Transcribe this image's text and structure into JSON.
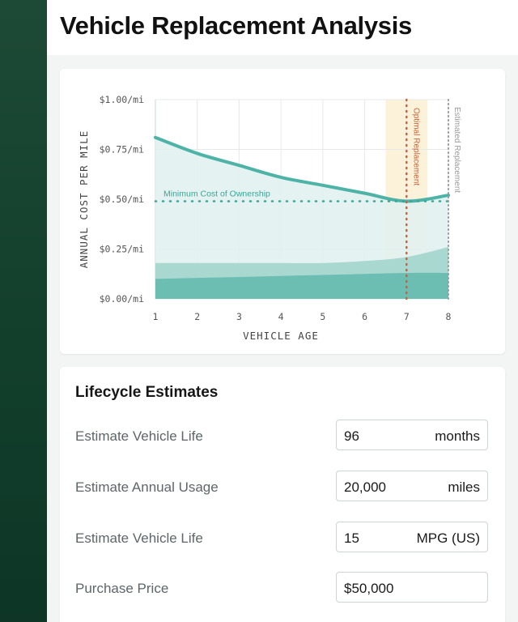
{
  "page": {
    "title": "Vehicle Replacement Analysis"
  },
  "chart_data": {
    "type": "area",
    "xlabel": "VEHICLE AGE",
    "ylabel": "ANNUAL COST PER MILE",
    "x": [
      1,
      2,
      3,
      4,
      5,
      6,
      7,
      8
    ],
    "xticks": [
      "1",
      "2",
      "3",
      "4",
      "5",
      "6",
      "7",
      "8"
    ],
    "yticks": [
      {
        "value": 0.0,
        "label": "$0.00/mi"
      },
      {
        "value": 0.25,
        "label": "$0.25/mi"
      },
      {
        "value": 0.5,
        "label": "$0.50/mi"
      },
      {
        "value": 0.75,
        "label": "$0.75/mi"
      },
      {
        "value": 1.0,
        "label": "$1.00/mi"
      }
    ],
    "xlim": [
      1,
      8
    ],
    "ylim": [
      0,
      1
    ],
    "grid": true,
    "series": [
      {
        "values": [
          0.81,
          0.73,
          0.67,
          0.61,
          0.57,
          0.53,
          0.49,
          0.52
        ],
        "color": "#4db3a7"
      },
      {
        "values": [
          0.18,
          0.18,
          0.18,
          0.18,
          0.18,
          0.19,
          0.21,
          0.26
        ],
        "color": "#a9d8d1"
      },
      {
        "values": [
          0.1,
          0.105,
          0.11,
          0.115,
          0.12,
          0.125,
          0.13,
          0.13
        ],
        "color": "#6cbdb2"
      }
    ],
    "annotations": [
      {
        "type": "hline",
        "y": 0.49,
        "label": "Minimum Cost of Ownership",
        "color": "#3aa597"
      },
      {
        "type": "vline",
        "x": 7,
        "label": "Optimal Replacement",
        "color": "#c8643a",
        "band": [
          6.5,
          7.5
        ],
        "band_color": "#fcf1d9"
      },
      {
        "type": "vline",
        "x": 8,
        "label": "Estimated Replacement",
        "color": "#9a9a9a"
      }
    ]
  },
  "form": {
    "title": "Lifecycle Estimates",
    "rows": [
      {
        "label": "Estimate Vehicle Life",
        "value": "96",
        "unit": "months"
      },
      {
        "label": "Estimate Annual Usage",
        "value": "20,000",
        "unit": "miles"
      },
      {
        "label": "Estimate Vehicle Life",
        "value": "15",
        "unit": "MPG (US)"
      },
      {
        "label": "Purchase Price",
        "value": "$50,000",
        "unit": ""
      }
    ]
  }
}
